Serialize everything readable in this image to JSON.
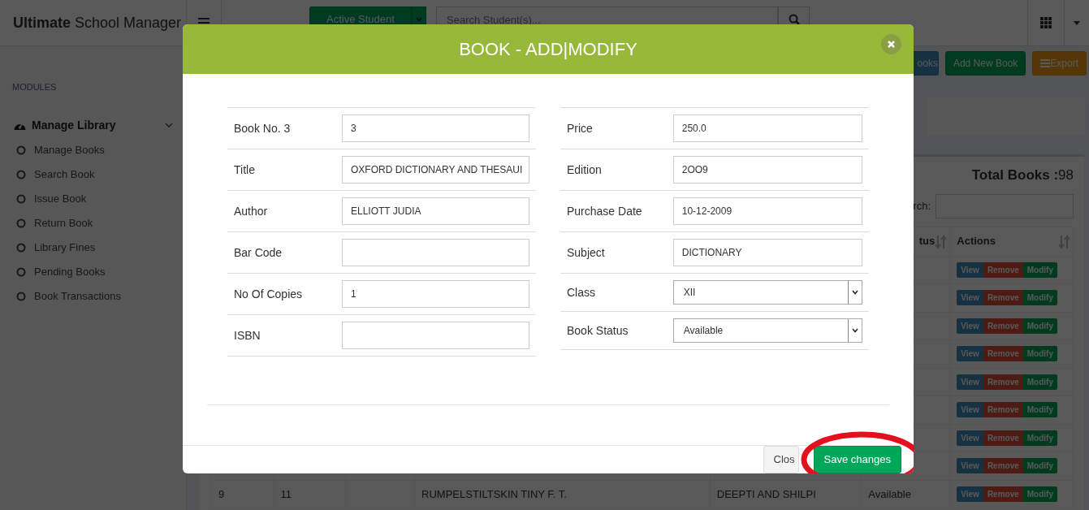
{
  "brand": "**Ultimate** School Manager",
  "navbar": {
    "student_filter": "Active Student",
    "search_placeholder": "Search Student(s)..."
  },
  "sidebar": {
    "heading": "MODULES",
    "groups": [
      {
        "label": "Manage Library",
        "expanded": true,
        "children": [
          {
            "label": "Manage Books"
          },
          {
            "label": "Search Book"
          },
          {
            "label": "Issue Book"
          },
          {
            "label": "Return Book"
          },
          {
            "label": "Library Fines"
          },
          {
            "label": "Pending Books"
          },
          {
            "label": "Book Transactions"
          }
        ]
      }
    ]
  },
  "toolbar": {
    "buttons": [
      {
        "label": "ooks",
        "kind": "info"
      },
      {
        "label": "Add New Book",
        "kind": "success"
      },
      {
        "label": "Export",
        "kind": "warning"
      }
    ]
  },
  "books_panel": {
    "total_label": "Total Books :",
    "total": "98",
    "search_label": "rch:",
    "columns": [
      {
        "label": "tus"
      },
      {
        "label": "Actions"
      }
    ],
    "rows": [
      {
        "actions": [
          "View",
          "Remove",
          "Modify"
        ]
      },
      {
        "actions": [
          "View",
          "Remove",
          "Modify"
        ]
      },
      {
        "actions": [
          "View",
          "Remove",
          "Modify"
        ]
      },
      {
        "actions": [
          "View",
          "Remove",
          "Modify"
        ]
      },
      {
        "actions": [
          "View",
          "Remove",
          "Modify"
        ]
      },
      {
        "actions": [
          "View",
          "Remove",
          "Modify"
        ]
      },
      {
        "actions": [
          "View",
          "Remove",
          "Modify"
        ]
      },
      {
        "actions": [
          "View",
          "Remove",
          "Modify"
        ]
      },
      {
        "column_1": "9",
        "column_2": "11",
        "column_4": "RUMPELSTILTSKIN TINY F. T.",
        "column_5": "DEEPTI AND SHILPI",
        "column_6": "Available",
        "actions": [
          "View",
          "Remove",
          "Modify"
        ]
      }
    ]
  },
  "modal": {
    "title": "BOOK - ADD|MODIFY",
    "left_fields": [
      {
        "label": "Book No. 3",
        "value": "3",
        "kind": "text"
      },
      {
        "label": "Title",
        "value": "OXFORD DICTIONARY AND THESAUI",
        "kind": "text"
      },
      {
        "label": "Author",
        "value": "ELLIOTT JUDIA",
        "kind": "text"
      },
      {
        "label": "Bar Code",
        "kind": "text"
      },
      {
        "label": "No Of Copies",
        "value": "1",
        "kind": "text"
      },
      {
        "label": "ISBN",
        "kind": "text"
      }
    ],
    "right_fields": [
      {
        "label": "Price",
        "value": "250.0",
        "kind": "text"
      },
      {
        "label": "Edition",
        "value": "2OO9",
        "kind": "text"
      },
      {
        "label": "Purchase Date",
        "value": "10-12-2009",
        "kind": "text"
      },
      {
        "label": "Subject",
        "value": "DICTIONARY",
        "kind": "text"
      },
      {
        "label": "Class",
        "value": "XII",
        "kind": "select"
      },
      {
        "label": "Book Status",
        "value": "Available",
        "kind": "select"
      }
    ],
    "buttons": [
      {
        "label": "Clos",
        "kind": "default",
        "highlighted": false
      },
      {
        "label": "Save changes",
        "kind": "success",
        "highlighted": true
      }
    ]
  }
}
